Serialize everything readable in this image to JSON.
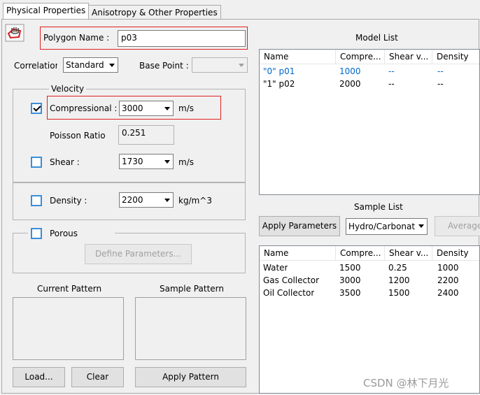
{
  "tabs": [
    {
      "label": "Physical Properties",
      "active": true
    },
    {
      "label": "Anisotropy & Other Properties",
      "active": false
    }
  ],
  "icon": "polygon-hand-icon",
  "polygon_name": {
    "label": "Polygon Name :",
    "value": "p03"
  },
  "correlation": {
    "label": "Correlation",
    "value": "Standard"
  },
  "base_point": {
    "label": "Base Point :",
    "value": ""
  },
  "velocity": {
    "title": "Velocity",
    "compressional": {
      "label": "Compressional :",
      "value": "3000",
      "unit": "m/s",
      "checked": true
    },
    "poisson": {
      "label": "Poisson Ratio",
      "value": "0.251"
    },
    "shear": {
      "label": "Shear :",
      "value": "1730",
      "unit": "m/s",
      "checked": false
    }
  },
  "density": {
    "label": "Density :",
    "value": "2200",
    "unit": "kg/m^3",
    "checked": false
  },
  "porous": {
    "label": "Porous",
    "checked": false,
    "button": "Define Parameters..."
  },
  "patterns": {
    "current": "Current Pattern",
    "sample": "Sample Pattern"
  },
  "buttons": {
    "load": "Load...",
    "clear": "Clear",
    "apply_pattern": "Apply Pattern"
  },
  "model_list": {
    "title": "Model List",
    "columns": [
      "Name",
      "Compre...",
      "Shear v...",
      "Density"
    ],
    "rows": [
      {
        "name": "\"0\" p01",
        "comp": "1000",
        "shear": "--",
        "density": "--",
        "highlight": true
      },
      {
        "name": "\"1\" p02",
        "comp": "2000",
        "shear": "--",
        "density": "--",
        "highlight": false
      }
    ]
  },
  "sample_list": {
    "title": "Sample List",
    "apply_button": "Apply Parameters",
    "type_value": "Hydro/Carbonat",
    "average_button": "Average",
    "columns": [
      "Name",
      "Compre...",
      "Shear v...",
      "Density"
    ],
    "rows": [
      {
        "name": "Water",
        "comp": "1500",
        "shear": "0.25",
        "density": "1000"
      },
      {
        "name": "Gas Collector",
        "comp": "3000",
        "shear": "1200",
        "density": "2200"
      },
      {
        "name": "Oil Collector",
        "comp": "3500",
        "shear": "1500",
        "density": "2400"
      }
    ]
  },
  "watermark": "CSDN @林下月光",
  "colors": {
    "highlight_row": "#0066cc",
    "annotation": "#e02020",
    "checkbox": "#3b8ed8"
  }
}
